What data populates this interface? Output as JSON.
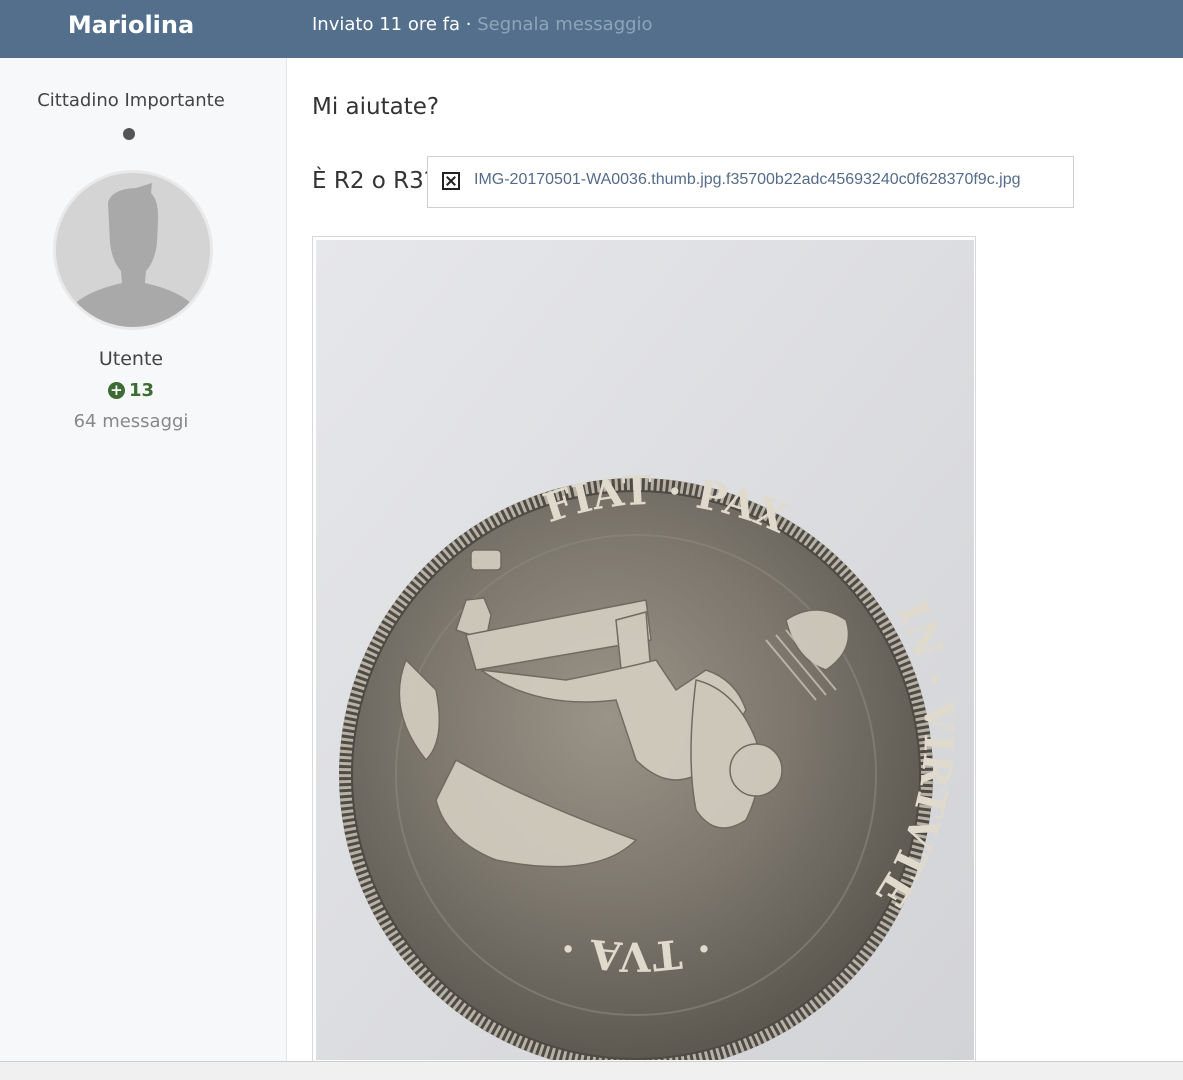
{
  "post": {
    "author": "Mariolina",
    "posted": "Inviato 11 ore fa ·",
    "report_link": "Segnala messaggio"
  },
  "profile": {
    "rank": "Cittadino Importante",
    "role": "Utente",
    "reputation": "13",
    "posts_count": "64 messaggi"
  },
  "content": {
    "line1": "Mi aiutate?",
    "line2": "È R2 o R3?",
    "broken_image_name": "IMG-20170501-WA0036.thumb.jpg.f35700b22adc45693240c0f628370f9c.jpg",
    "coin_legend_top": "FIAT · PAX",
    "coin_legend_right": "IN · VIRTVTE",
    "coin_legend_bottom": "· TVA ·"
  },
  "colors": {
    "header": "#536f8b",
    "reputation": "#3d6b34",
    "report_link": "#8fa4bb"
  },
  "icons": [
    "status-dot",
    "avatar-placeholder",
    "plus-circle-icon",
    "broken-image-icon"
  ]
}
